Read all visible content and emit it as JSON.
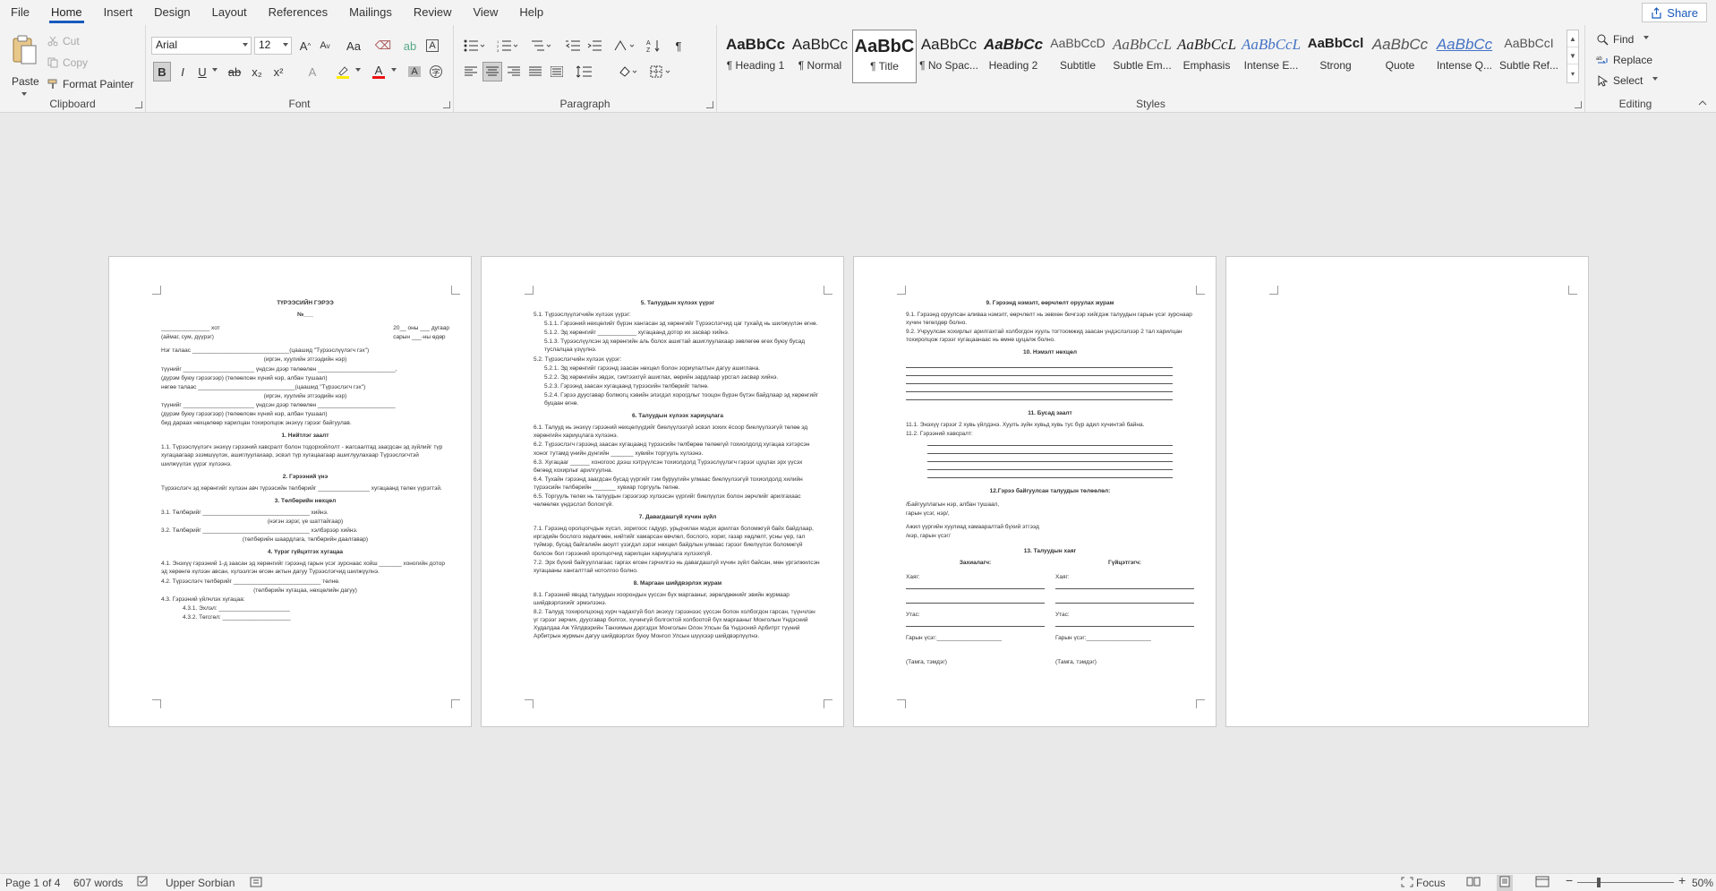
{
  "menu": {
    "tabs": [
      "File",
      "Home",
      "Insert",
      "Design",
      "Layout",
      "References",
      "Mailings",
      "Review",
      "View",
      "Help"
    ],
    "active": "Home",
    "share": "Share"
  },
  "clipboard": {
    "paste": "Paste",
    "cut": "Cut",
    "copy": "Copy",
    "format_painter": "Format Painter",
    "label": "Clipboard"
  },
  "font": {
    "name": "Arial",
    "size": "12",
    "label": "Font",
    "grow": "A",
    "shrink": "A",
    "case": "Aa",
    "bold": "B",
    "italic": "I",
    "underline": "U",
    "strike": "ab",
    "sub": "x₂",
    "sup": "x²"
  },
  "paragraph": {
    "label": "Paragraph"
  },
  "styles": {
    "label": "Styles",
    "items": [
      {
        "sample": "AaBbCc",
        "name": "¶ Heading 1"
      },
      {
        "sample": "AaBbCc",
        "name": "¶ Normal"
      },
      {
        "sample": "AaBbC",
        "name": "¶ Title"
      },
      {
        "sample": "AaBbCc",
        "name": "¶ No Spac..."
      },
      {
        "sample": "AaBbCc",
        "name": "Heading 2"
      },
      {
        "sample": "AaBbCcD",
        "name": "Subtitle"
      },
      {
        "sample": "AaBbCcL",
        "name": "Subtle Em..."
      },
      {
        "sample": "AaBbCcL",
        "name": "Emphasis"
      },
      {
        "sample": "AaBbCcL",
        "name": "Intense E..."
      },
      {
        "sample": "AaBbCcl",
        "name": "Strong"
      },
      {
        "sample": "AaBbCc",
        "name": "Quote"
      },
      {
        "sample": "AaBbCc",
        "name": "Intense Q..."
      },
      {
        "sample": "AaBbCcI",
        "name": "Subtle Ref..."
      }
    ]
  },
  "editing": {
    "label": "Editing",
    "find": "Find",
    "replace": "Replace",
    "select": "Select"
  },
  "pages": {
    "p1": {
      "title": "ТҮРЭЭСИЙН ГЭРЭЭ",
      "number": "№___",
      "place_left": "_______________ хот",
      "place_left2": "(аймаг, сум, дүүрэг)",
      "date_right": "20__ оны ___ дугаар",
      "date_right2": "сарын ___-ны өдөр",
      "party1": "Нэг талаас ______________________________(цаашид \"Түрээслүүлэгч гэх\")",
      "party1b": "(иргэн, хуулийн этгээдийн нэр)",
      "party1c": "түүнийг ______________________ үндсэн дээр төлөөлөн ________________________,",
      "party1d": "(дүрэм буюу гэрээгээр)                                                (төлөөлсөн хүний нэр, албан тушаал)",
      "party2": "нөгөө талаас ______________________________(цаашид \"Түрээслэгч гэх\")",
      "party2b": "(иргэн, хуулийн этгээдийн нэр)",
      "party2c": "түүнийг ______________________ үндсэн дээр төлөөлөн ________________________",
      "party2d": "(дүрэм буюу гэрээгээр)                                                (төлөөлсөн хүний нэр, албан тушаал)",
      "agree": "бид дараах нөхцөлөөр харилцан тохиролцож энэхүү гэрээг байгуулав.",
      "h1": "1. Нийтлэг заалт",
      "s1": "1.1. Түрээслүүлэгч энэхүү гэрээний хавсралт болон тодорхойлолт - жагсаалтад заагдсан эд зүйлийг түр хугацаагаар эзэмшүүлэх, ашиглуулахаар, эсвэл түр хугацаагаар ашиглуулахаар Түрээслэгчтэй шилжүүлэх үүрэг хүлээнэ.",
      "h2": "2. Гэрээний үнэ",
      "s2": "Түрээслэгч эд хөрөнгийг хүлээн авч түрээсийн төлбөрийг ________________ хугацаанд төлөх үүрэгтэй.",
      "h3": "3. Төлбөрийн нөхцөл",
      "s3a": "3.1. Төлбөрийг _________________________________ хийнэ.",
      "s3b": "(нэгэн зэрэг, үе шаттайгаар)",
      "s3c": "3.2. Төлбөрийг _________________________________ хэлбэрээр хийнэ.",
      "s3d": "(төлбөрийн шаардлага, төлбөрийн даалгавар)",
      "h4": "4. Үүрэг гүйцэтгэх хугацаа",
      "s4a": "4.1. Энэхүү гэрээний 1-д заасан эд хөрөнгийг гэрээнд гарын үсэг зурснаас хойш _______ хоногийн дотор эд хөрөнгө хүлээн авсан, хүлээлгэн өгсөн актын дагуу Түрээслэгчид шилжүүлнэ.",
      "s4b": "4.2. Түрээслэгч төлбөрийг ___________________________ төлнө.",
      "s4c": "(төлбөрийн хугацаа, нөхцөлийн дагуу)",
      "s4d": "4.3. Гэрээний үйлчлэх хугацаа:",
      "s4e": "4.3.1. Эхлэл: ______________________",
      "s4f": "4.3.2. Төгсгөл: _____________________"
    },
    "p2": {
      "h5": "5. Талуудын хүлээх үүрэг",
      "s51": "5.1. Түрээслүүлэгчийн хүлээх үүрэг:",
      "s511": "5.1.1. Гэрээний нөхцөлийг бүрэн хангасан эд хөрөнгийг Түрээслэгчид цаг тухайд нь шилжүүлэн өгнө.",
      "s512": "5.1.2. Эд хөрөнгийг ____________ хугацаанд дотор их засвар хийнэ.",
      "s513": "5.1.3. Түрээслүүлсэн эд хөрөнгийн аль болох ашигтай ашиглуулахаар зөвлөгөө өгөх буюу бусад туслалцаа үзүүлнэ.",
      "s52": "5.2. Түрээслэгчийн хүлээх үүрэг:",
      "s521": "5.2.1. Эд хөрөнгийг гэрээнд заасан нөхцөл болон зориулалтын дагуу ашиглана.",
      "s522": "5.2.2. Эд хөрөнгийн эвдэх, гэмтээхгүй ашиглах, өөрийн зардлаар урсгал засвар хийнэ.",
      "s523": "5.2.3. Гэрээнд заасан хугацаанд түрээсийн төлбөрийг төлнө.",
      "s524": "5.2.4. Гэрээ дуусгавар болмогц хэвийн элэгдэл хорогдлыг тооцон бүрэн бүтэн байдлаар эд хөрөнгийг буцаан өгнө.",
      "h6": "6. Талуудын хүлээх хариуцлага",
      "s61": "6.1. Талууд нь энэхүү гэрээний нөхцөлүүдийг биелүүлээгүй эсвэл зохих ёсоор биелүүлээгүй төлөө эд хөрөнгийн хариуцлага хүлээнэ.",
      "s62": "6.2. Түрээслэгч гэрээнд заасан хугацаанд түрээсийн төлбөрөө төлөөгүй тохиолдолд хугацаа хэтэрсэн хоног тутамд үнийн дүнгийн _______ хувийн торгууль хүлээнэ.",
      "s63": "6.3. Хугацааг ______ хоногоос дээш хэтрүүлсэн тохиолдолд Түрээслүүлэгч гэрээг цуцлах эрх үүсэх бөгөөд хохирлыг арилгуулна.",
      "s64": "6.4. Тухайн гэрээнд заагдсан бусад үүргийг гэм буруугийн улмаас биелүүлээгүй тохиолдолд хилийн түрээсийн төлбөрийн _______ хувиар торгууль төлнө.",
      "s65": "6.5. Торгууль төлөх нь талуудын гэрээгээр хүлээсэн үүргийг биелүүлэх болон зөрчлийг арилгахаас чөлөөлөх үндэслэл болохгүй.",
      "h7": "7. Давагдашгүй хүчин зүйл",
      "s71": "7.1. Гэрээнд оролцогчдын хүсэл, зоригоос гадуур, урьдчилан мэдэх арилгах боломжгүй байх байдлаар, иргэдийн бослого хөдөлгөөн, нийтийг хамарсан өвчлөл, бослого, хориг, газар хөдлөлт, усны үер, гал түймэр, бусад байгалийн аюулт үзэгдэл зэрэг нөхцөл байдлын улмаас гэрээг биелүүлэх боломжгүй болсон бол гэрээний оролцогчид харилцан хариуцлага хүлээхгүй.",
      "s72": "7.2. Эрх бүхий байгууллагаас гаргах өгсөн гэрчилгээ нь давагдашгүй хүчин зүйл байсан, мөн үргэлжилсэн хугацааны хангалттай нотолгоо болно.",
      "h8": "8. Маргаан шийдвэрлэх журам",
      "s81": "8.1. Гэрээний явцад талуудын хоорондын үүссэн бүх маргааныг, зөрөлдөөнийг эвийн журмаар шийдвэрлэхийг эрмэлзэнэ.",
      "s82": "8.2. Талууд тохиролцоонд хүрч чадахгүй бол энэхүү гэрээнээс үүссэн болон холбогдон гарсан, түүнчлэн үг гэрээг зөрчих, дуусгавар болгох, хүчингүй болгохтой холбоотой бүх маргааныг Монголын Үндэсний Худалдаа Аж Үйлдвэрийн Танхимын дэргэдэх Монголын Олон Улсын ба Үндэсний Арбитрт түүний Арбитрын журмын дагуу шийдвэрлэх буюу Монгол Улсын шүүхээр шийдвэрлүүлнэ."
    },
    "p3": {
      "h9": "9. Гэрээнд нэмэлт, өөрчлөлт оруулах журам",
      "s91": "9.1. Гэрээнд оруулсан аливаа нэмэлт, өөрчлөлт нь зөвхөн бичгээр хийгдэж талуудын гарын үсэг зурснаар хүчин төгөлдөр болно.",
      "s92": "9.2. Учруулсан хохирлыг арилгахтай холбогдон хууль тогтоомжид заасан үндэслэлээр 2 тал харилцан тохиролцож гэрээг хугацаанаас нь өмнө цуцалж болно.",
      "h10": "10. Нэмэлт нөхцөл",
      "h11": "11. Бусад заалт",
      "s111": "11.1. Энэхүү гэрээг 2 хувь үйлдэнэ. Хуулъ зүйн хувьд хувь тус бүр адил хүчинтэй байна.",
      "s112": "11.2. Гэрээний хавсралт:",
      "h12": "12.Гэрээ байгуулсан талуудын төлөөлөл:",
      "s121": "/Байгууллагын нэр, албан тушаал,",
      "s122": "гарын үсэг, нэр/,",
      "s123": "Ажил үүргийн хуулиад хамааралтай бүхий этгээд",
      "s124": "/нэр, гарын үсэг/",
      "h13": "13. Талуудын хаяг",
      "left_t": "Захиалагч:",
      "right_t": "Гүйцэтгэгч:",
      "addr": "Хаяг:",
      "phone": "Утас:",
      "sign": "Гарын үсэг:____________________",
      "stamp": "(Тамга, тэмдэг)"
    }
  },
  "status": {
    "page": "Page 1 of 4",
    "words": "607 words",
    "language": "Upper Sorbian",
    "focus": "Focus",
    "zoom": "50%",
    "zoom_level": 0.5
  }
}
